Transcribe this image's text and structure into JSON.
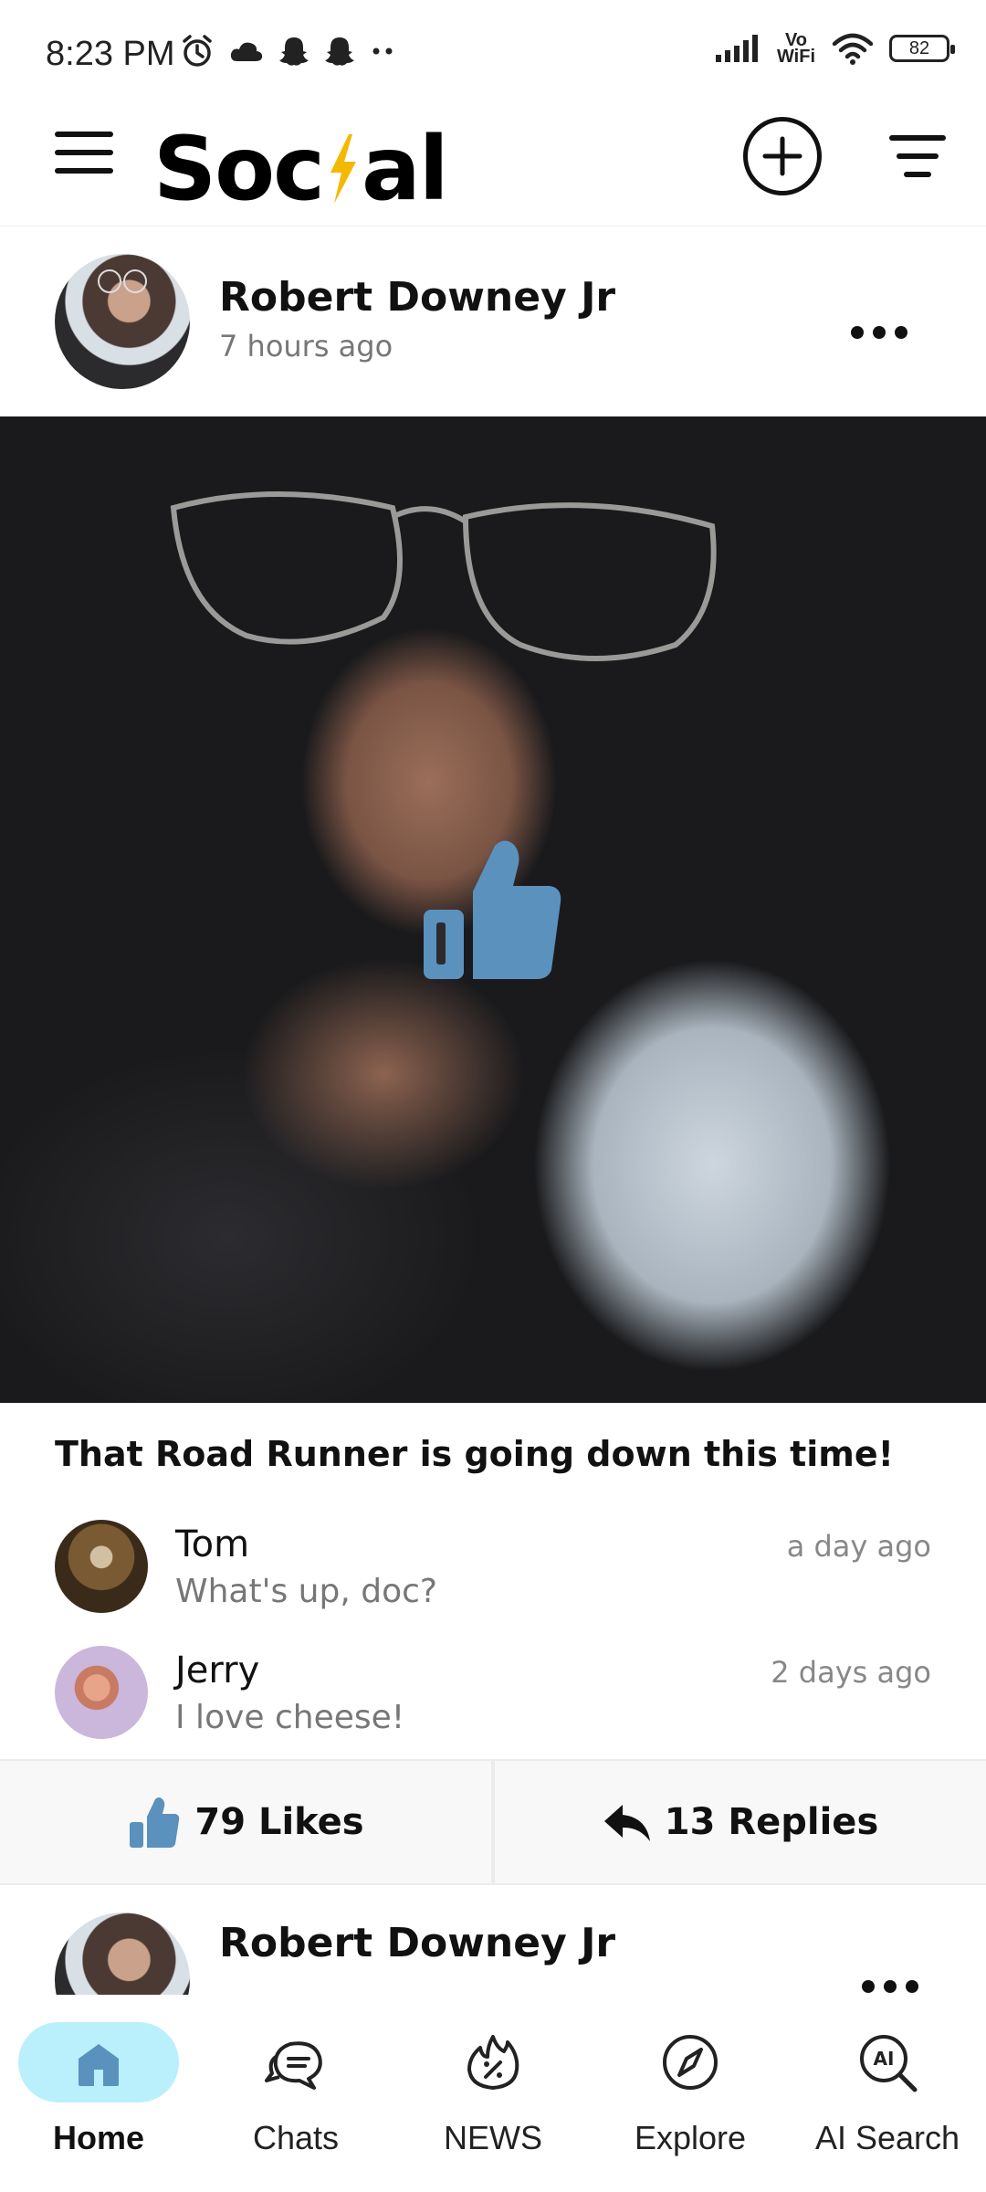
{
  "status_bar": {
    "time": "8:23 PM",
    "network_label": "Vo WiFi",
    "battery": "82"
  },
  "app": {
    "logo_pre": "Soc",
    "logo_post": "al",
    "accent_color": "#f5b800"
  },
  "post": {
    "author": "Robert Downey Jr",
    "time": "7 hours ago",
    "caption": "That Road Runner is going down this time!",
    "like_color": "#5b91bd",
    "comments": [
      {
        "name": "Tom",
        "text": "What's up, doc?",
        "time": "a day ago"
      },
      {
        "name": "Jerry",
        "text": "I love cheese!",
        "time": "2 days ago"
      }
    ],
    "likes_label": "79 Likes",
    "replies_label": "13 Replies"
  },
  "next_post": {
    "author": "Robert Downey Jr"
  },
  "bottom_nav": {
    "items": [
      {
        "label": "Home",
        "icon": "home-icon",
        "active": true
      },
      {
        "label": "Chats",
        "icon": "chat-icon",
        "active": false
      },
      {
        "label": "NEWS",
        "icon": "fire-percent-icon",
        "active": false
      },
      {
        "label": "Explore",
        "icon": "compass-icon",
        "active": false
      },
      {
        "label": "AI Search",
        "icon": "ai-search-icon",
        "active": false
      }
    ],
    "active_color": "#b9f0fb"
  }
}
